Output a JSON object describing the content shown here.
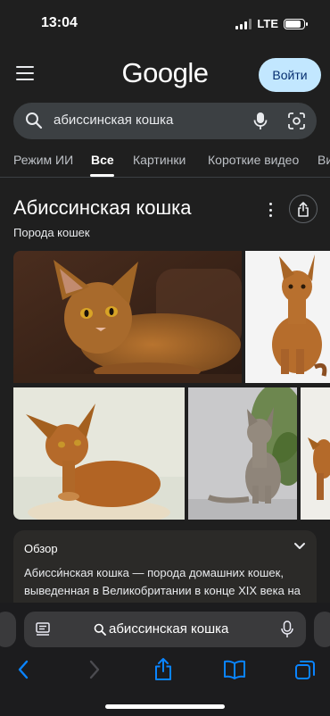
{
  "status": {
    "time": "13:04",
    "network": "LTE"
  },
  "header": {
    "logo": "Google",
    "login_label": "Войти"
  },
  "search": {
    "query": "абиссинская кошка"
  },
  "tabs": [
    {
      "label": "Режим ИИ"
    },
    {
      "label": "Все",
      "active": true
    },
    {
      "label": "Картинки"
    },
    {
      "label": "Короткие видео"
    },
    {
      "label": "Ви"
    }
  ],
  "knowledge_panel": {
    "title": "Абиссинская кошка",
    "subtitle": "Порода кошек"
  },
  "overview": {
    "heading": "Обзор",
    "text": "Абисси́нская кошка — порода домашних кошек, выведенная в Великобритании в конце XIX века на основе аборигенных пород кошек Восточной"
  },
  "browser": {
    "address_text": "абиссинская кошка"
  },
  "colors": {
    "accent": "#c2e7ff",
    "ios_blue": "#0a84ff",
    "background": "#1f1f1f"
  },
  "icons": [
    "menu-icon",
    "search-icon",
    "mic-icon",
    "lens-icon",
    "more-icon",
    "share-icon",
    "chevron-down-icon",
    "reader-icon",
    "back-icon",
    "forward-icon",
    "bookmarks-icon",
    "tabs-icon"
  ]
}
